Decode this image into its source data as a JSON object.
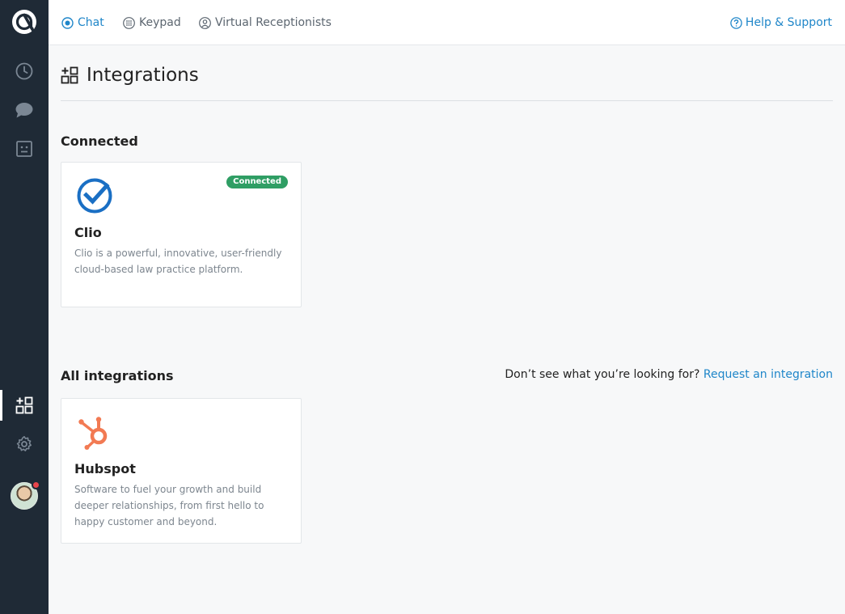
{
  "top_nav": {
    "tabs": [
      {
        "label": "Chat",
        "icon": "chat-bubble-icon",
        "active": true
      },
      {
        "label": "Keypad",
        "icon": "keypad-icon",
        "active": false
      },
      {
        "label": "Virtual Receptionists",
        "icon": "receptionist-icon",
        "active": false
      }
    ],
    "help_label": "Help & Support"
  },
  "sidebar": {
    "items": [
      {
        "name": "history",
        "icon": "clock-icon"
      },
      {
        "name": "messages",
        "icon": "message-icon"
      },
      {
        "name": "contacts",
        "icon": "contact-card-icon"
      },
      {
        "name": "integrations",
        "icon": "integrations-icon",
        "active": true
      },
      {
        "name": "settings",
        "icon": "gear-icon"
      }
    ]
  },
  "page": {
    "title": "Integrations"
  },
  "connected": {
    "section_title": "Connected",
    "cards": [
      {
        "name": "Clio",
        "description": "Clio is a powerful, innovative, user-friendly cloud-based law practice platform.",
        "badge": "Connected"
      }
    ]
  },
  "all": {
    "section_title": "All integrations",
    "request_prompt": "Don’t see what you’re looking for?",
    "request_link": "Request an integration",
    "cards": [
      {
        "name": "Hubspot",
        "description": "Software to fuel your growth and build deeper relationships, from first hello to happy customer and beyond."
      }
    ]
  },
  "colors": {
    "sidebar_bg": "#1f2a36",
    "accent_blue": "#1f86c9",
    "connected_green": "#2f9e64",
    "clio_blue": "#1a6fc4",
    "hubspot_orange": "#f27a53",
    "notification_red": "#e8454b"
  }
}
